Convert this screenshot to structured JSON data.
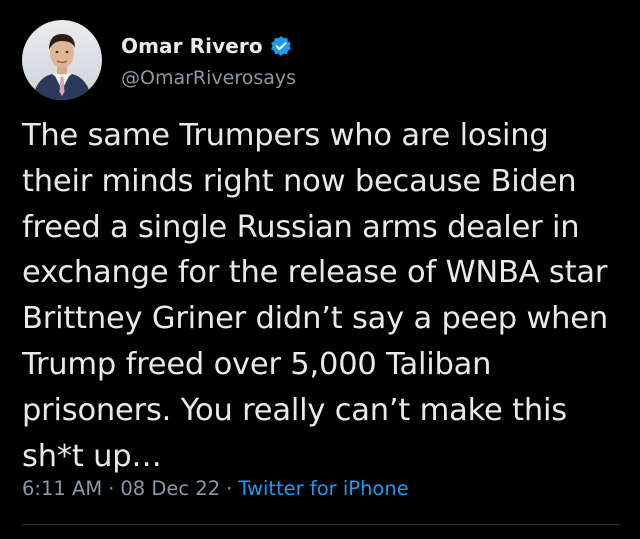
{
  "author": {
    "display_name": "Omar Rivero",
    "handle": "@OmarRiverosays",
    "verified": true,
    "avatar": "profile-photo"
  },
  "tweet": {
    "text": "The same Trumpers who are losing their minds right now because Biden freed a single Russian arms dealer in exchange for the release of WNBA star Brittney Griner didn’t say a peep when Trump freed over 5,000 Taliban prisoners. You really can’t make this sh*t up…"
  },
  "meta": {
    "time": "6:11 AM",
    "separator_1": "·",
    "date": "08 Dec 22",
    "separator_2": "·",
    "source": "Twitter for iPhone"
  },
  "colors": {
    "background": "#000000",
    "text": "#e7e9ea",
    "secondary": "#8b98a5",
    "accent": "#1d9bf0",
    "divider": "#2f3336"
  },
  "icons": {
    "verified": "verified-badge-icon"
  }
}
